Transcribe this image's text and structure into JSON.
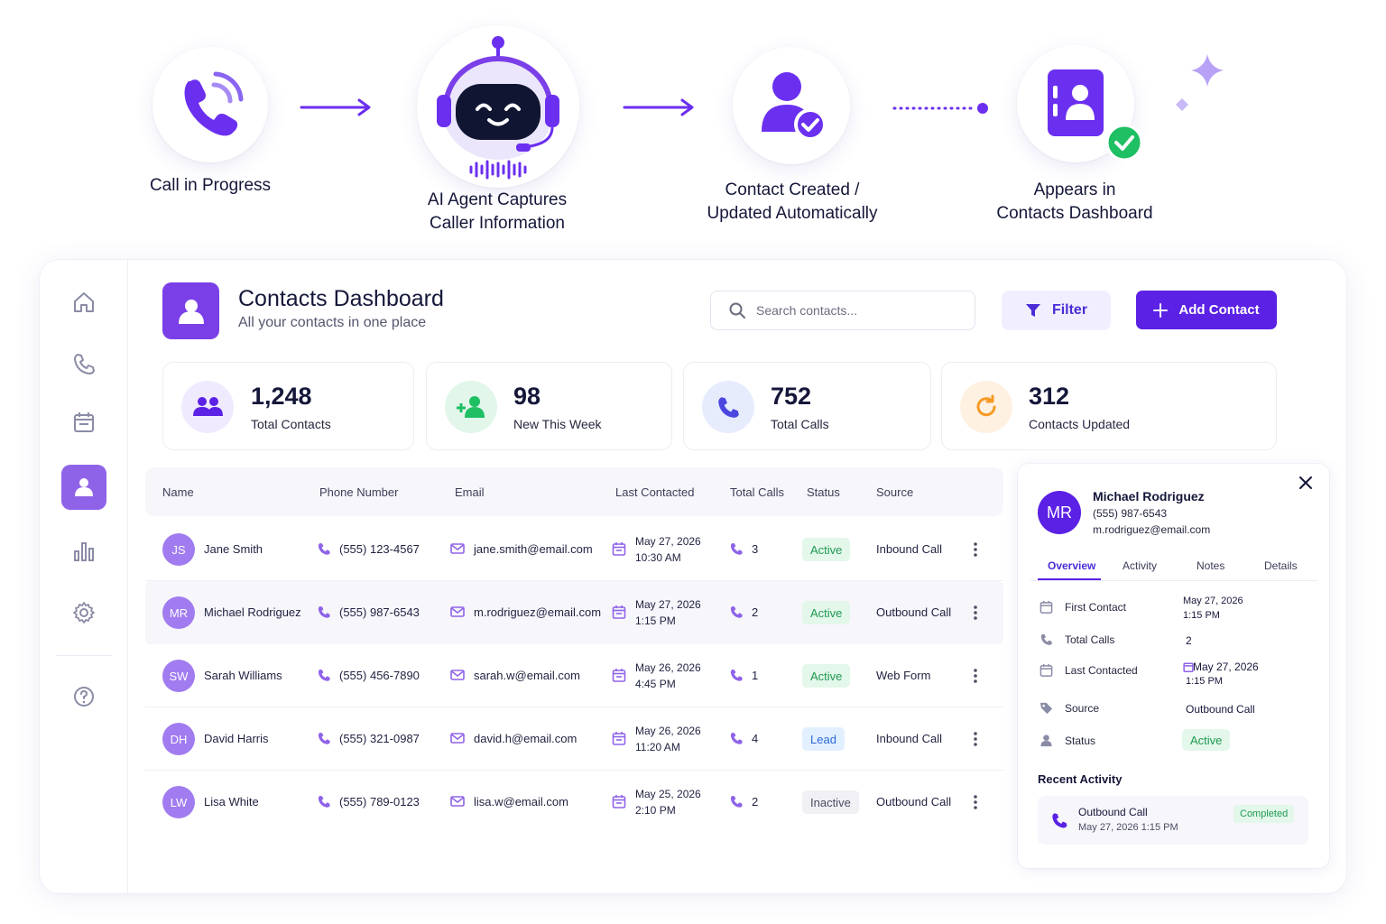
{
  "flow": {
    "steps": [
      {
        "lines": [
          "Call in Progress"
        ]
      },
      {
        "lines": [
          "AI Agent Captures",
          "Caller Information"
        ]
      },
      {
        "lines": [
          "Contact Created /",
          "Updated Automatically"
        ]
      },
      {
        "lines": [
          "Appears in",
          "Contacts Dashboard"
        ]
      }
    ],
    "colors": {
      "accent": "#6b2ff0",
      "success": "#1fbf63"
    }
  },
  "sidebar": {
    "items": [
      {
        "icon": "home-icon"
      },
      {
        "icon": "phone-icon"
      },
      {
        "icon": "calendar-icon"
      },
      {
        "icon": "contacts-icon",
        "active": true
      },
      {
        "icon": "bar-chart-icon"
      },
      {
        "icon": "gear-icon"
      },
      {
        "icon": "help-icon"
      }
    ]
  },
  "header": {
    "title": "Contacts Dashboard",
    "subtitle": "All your contacts in one place",
    "search_placeholder": "Search contacts...",
    "filter_label": "Filter",
    "add_label": "Add Contact"
  },
  "stats": [
    {
      "value": "1,248",
      "label": "Total Contacts"
    },
    {
      "value": "98",
      "label": "New This Week"
    },
    {
      "value": "752",
      "label": "Total Calls"
    },
    {
      "value": "312",
      "label": "Contacts Updated"
    }
  ],
  "table": {
    "columns": [
      "Name",
      "Phone Number",
      "Email",
      "Last Contacted",
      "Total Calls",
      "Status",
      "Source"
    ],
    "rows": [
      {
        "initials": "JS",
        "name": "Jane Smith",
        "phone": "(555) 123-4567",
        "email": "jane.smith@email.com",
        "date": "May 27, 2026",
        "time": "10:30 AM",
        "calls": "3",
        "status": "Active",
        "source": "Inbound Call"
      },
      {
        "initials": "MR",
        "name": "Michael Rodriguez",
        "phone": "(555) 987-6543",
        "email": "m.rodriguez@email.com",
        "date": "May 27, 2026",
        "time": "1:15 PM",
        "calls": "2",
        "status": "Active",
        "source": "Outbound Call"
      },
      {
        "initials": "SW",
        "name": "Sarah Williams",
        "phone": "(555) 456-7890",
        "email": "sarah.w@email.com",
        "date": "May 26, 2026",
        "time": "4:45 PM",
        "calls": "1",
        "status": "Active",
        "source": "Web Form"
      },
      {
        "initials": "DH",
        "name": "David Harris",
        "phone": "(555) 321-0987",
        "email": "david.h@email.com",
        "date": "May 26, 2026",
        "time": "11:20 AM",
        "calls": "4",
        "status": "Lead",
        "source": "Inbound Call"
      },
      {
        "initials": "LW",
        "name": "Lisa White",
        "phone": "(555) 789-0123",
        "email": "lisa.w@email.com",
        "date": "May 25, 2026",
        "time": "2:10 PM",
        "calls": "2",
        "status": "Inactive",
        "source": "Outbound Call"
      }
    ]
  },
  "detail": {
    "initials": "MR",
    "name": "Michael Rodriguez",
    "phone": "(555) 987-6543",
    "email": "m.rodriguez@email.com",
    "tabs": [
      "Overview",
      "Activity",
      "Notes",
      "Details"
    ],
    "fields": {
      "first_contact_label": "First Contact",
      "first_contact_date": "May 27, 2026",
      "first_contact_time": "1:15 PM",
      "total_calls_label": "Total Calls",
      "total_calls_value": "2",
      "last_contacted_label": "Last Contacted",
      "last_contacted_date": "May 27, 2026",
      "last_contacted_time": "1:15 PM",
      "source_label": "Source",
      "source_value": "Outbound Call",
      "status_label": "Status",
      "status_value": "Active"
    },
    "recent_title": "Recent Activity",
    "activity": {
      "title": "Outbound Call",
      "time": "May 27, 2026 1:15 PM",
      "badge": "Completed"
    }
  }
}
